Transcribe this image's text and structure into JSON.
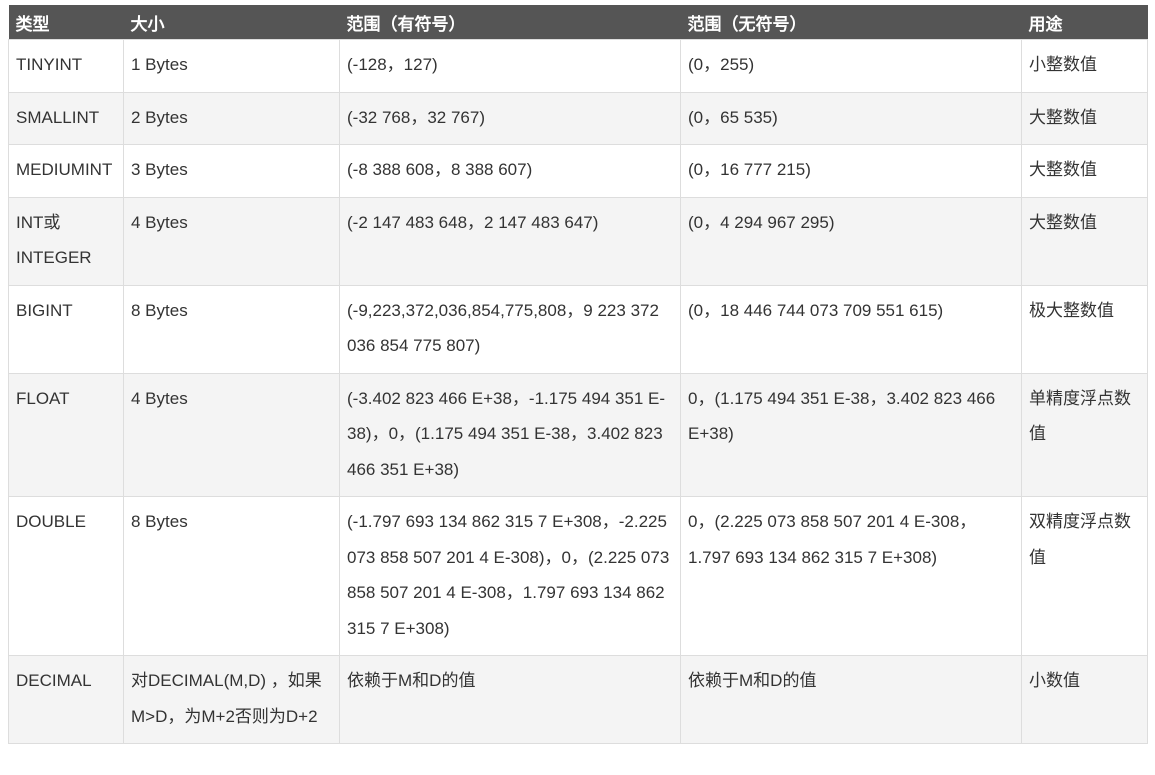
{
  "table": {
    "headers": [
      "类型",
      "大小",
      "范围（有符号）",
      "范围（无符号）",
      "用途"
    ],
    "rows": [
      {
        "type": "TINYINT",
        "size": "1 Bytes",
        "signed": "(-128，127)",
        "unsigned": "(0，255)",
        "usage": "小整数值"
      },
      {
        "type": "SMALLINT",
        "size": "2 Bytes",
        "signed": "(-32 768，32 767)",
        "unsigned": "(0，65 535)",
        "usage": "大整数值"
      },
      {
        "type": "MEDIUMINT",
        "size": "3 Bytes",
        "signed": "(-8 388 608，8 388 607)",
        "unsigned": "(0，16 777 215)",
        "usage": "大整数值"
      },
      {
        "type": "INT或INTEGER",
        "size": "4 Bytes",
        "signed": "(-2 147 483 648，2 147 483 647)",
        "unsigned": "(0，4 294 967 295)",
        "usage": "大整数值"
      },
      {
        "type": "BIGINT",
        "size": "8 Bytes",
        "signed": "(-9,223,372,036,854,775,808，9 223 372 036 854 775 807)",
        "unsigned": "(0，18 446 744 073 709 551 615)",
        "usage": "极大整数值"
      },
      {
        "type": "FLOAT",
        "size": "4 Bytes",
        "signed": "(-3.402 823 466 E+38，-1.175 494 351 E-38)，0，(1.175 494 351 E-38，3.402 823 466 351 E+38)",
        "unsigned": "0，(1.175 494 351 E-38，3.402 823 466 E+38)",
        "usage": "单精度浮点数值"
      },
      {
        "type": "DOUBLE",
        "size": "8 Bytes",
        "signed": "(-1.797 693 134 862 315 7 E+308，-2.225 073 858 507 201 4 E-308)，0，(2.225 073 858 507 201 4 E-308，1.797 693 134 862 315 7 E+308)",
        "unsigned": "0，(2.225 073 858 507 201 4 E-308，1.797 693 134 862 315 7 E+308)",
        "usage": "双精度浮点数值"
      },
      {
        "type": "DECIMAL",
        "size": "对DECIMAL(M,D) ，如果M>D，为M+2否则为D+2",
        "signed": "依赖于M和D的值",
        "unsigned": "依赖于M和D的值",
        "usage": "小数值"
      }
    ]
  }
}
